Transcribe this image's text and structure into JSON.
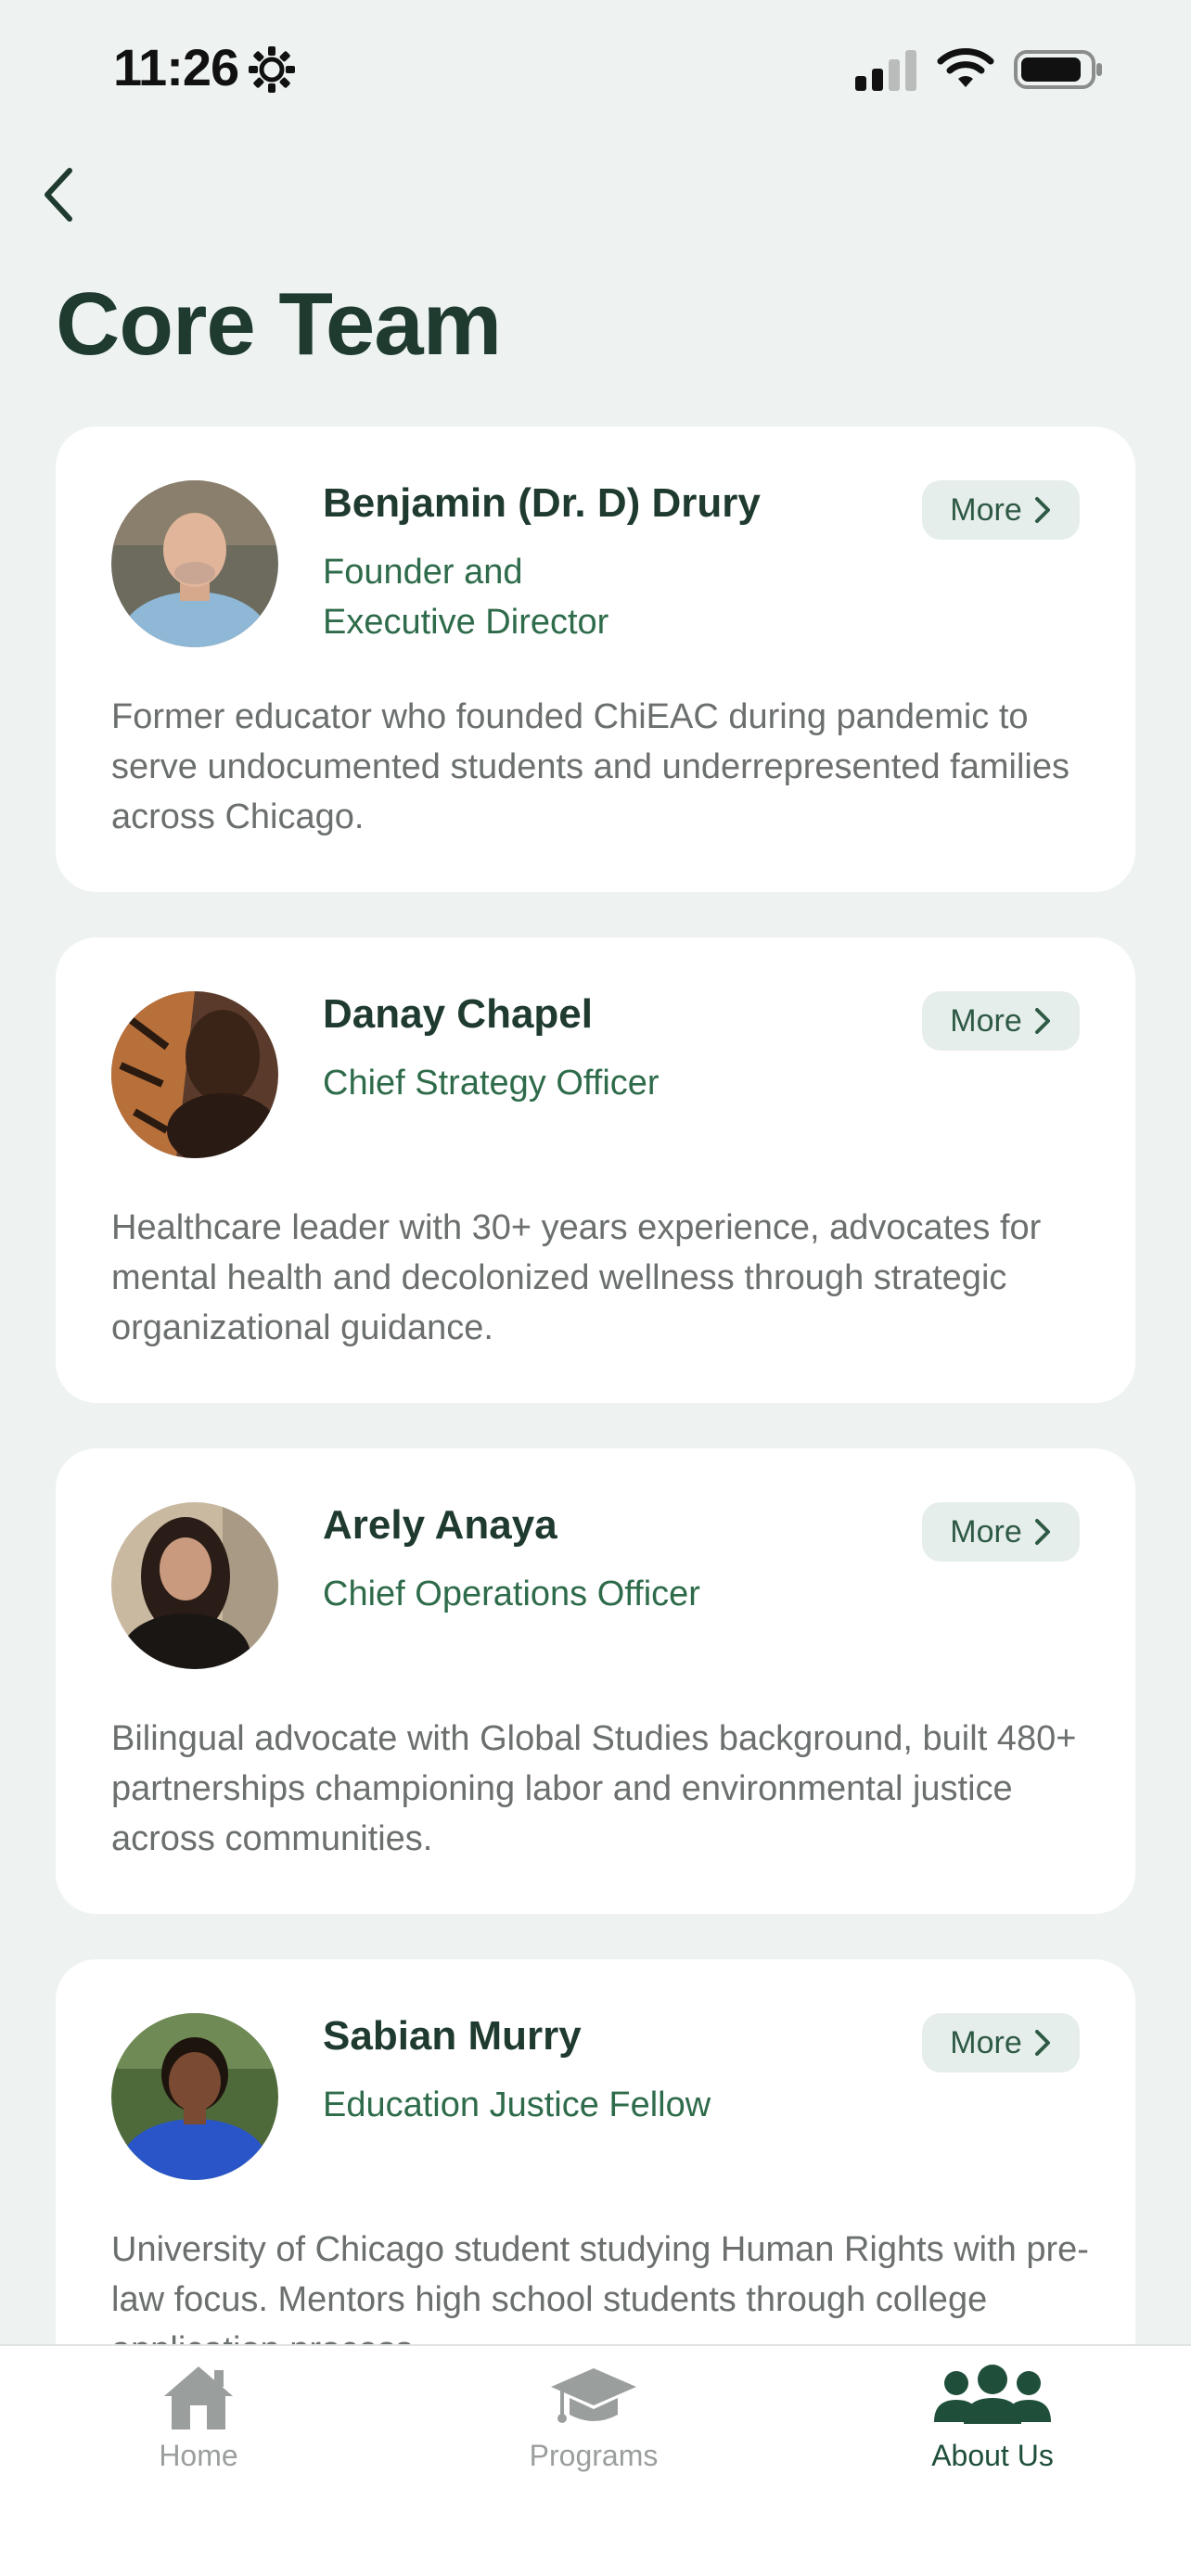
{
  "status_bar": {
    "time": "11:26"
  },
  "header": {
    "title": "Core Team"
  },
  "team": [
    {
      "name": "Benjamin (Dr. D) Drury",
      "role_lines": [
        "Founder and",
        "Executive Director"
      ],
      "bio": "Former educator who founded ChiEAC during pandemic to serve undocumented students and underrepresented families across Chicago.",
      "more_label": "More"
    },
    {
      "name": "Danay Chapel",
      "role_lines": [
        "Chief Strategy Officer"
      ],
      "bio": "Healthcare leader with 30+ years experience, advocates for mental health and decolonized wellness through strategic organizational guidance.",
      "more_label": "More"
    },
    {
      "name": "Arely Anaya",
      "role_lines": [
        "Chief Operations Officer"
      ],
      "bio": "Bilingual advocate with Global Studies background, built 480+ partnerships championing labor and environmental justice across communities.",
      "more_label": "More"
    },
    {
      "name": "Sabian Murry",
      "role_lines": [
        "Education Justice Fellow"
      ],
      "bio": "University of Chicago student studying Human Rights with pre-law focus. Mentors high school students through college application process.",
      "more_label": "More"
    }
  ],
  "tab_bar": {
    "tabs": [
      {
        "label": "Home",
        "icon": "home-icon",
        "active": false
      },
      {
        "label": "Programs",
        "icon": "graduation-cap-icon",
        "active": false
      },
      {
        "label": "About Us",
        "icon": "people-icon",
        "active": true
      }
    ]
  },
  "colors": {
    "background": "#eef3f2",
    "card": "#ffffff",
    "title": "#1f3a2e",
    "role": "#2e6b4a",
    "bio": "#6b6f6d",
    "more_button_bg": "#e6eeec",
    "tab_active": "#1f4f3a",
    "tab_inactive": "#9a9e9c"
  }
}
